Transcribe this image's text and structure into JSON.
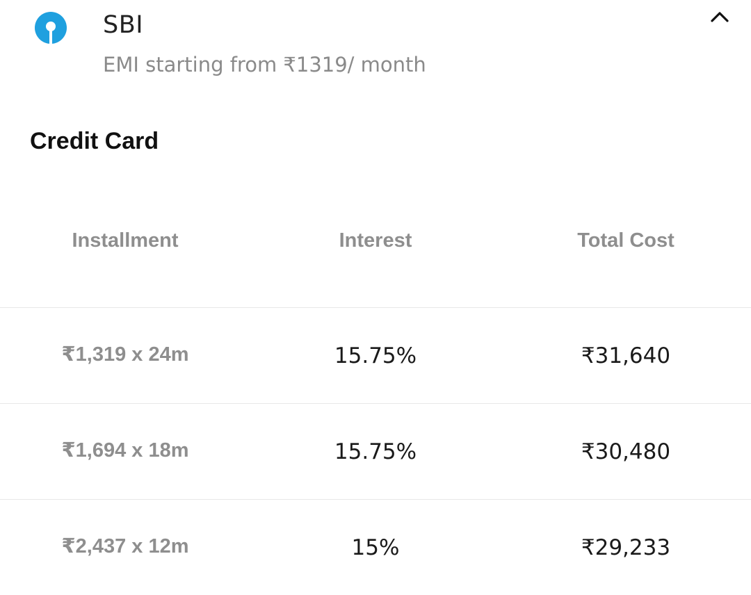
{
  "bank": {
    "name": "SBI",
    "emi_text": "EMI starting from ₹1319/ month",
    "logo_icon": "sbi-logo-icon",
    "brand_color": "#1fa0df",
    "collapse_icon": "chevron-up-icon"
  },
  "section": {
    "title": "Credit Card"
  },
  "table": {
    "headers": [
      "Installment",
      "Interest",
      "Total Cost"
    ],
    "rows": [
      {
        "installment": "₹1,319 x 24m",
        "interest": "15.75%",
        "total": "₹31,640"
      },
      {
        "installment": "₹1,694 x 18m",
        "interest": "15.75%",
        "total": "₹30,480"
      },
      {
        "installment": "₹2,437 x 12m",
        "interest": "15%",
        "total": "₹29,233"
      }
    ]
  }
}
